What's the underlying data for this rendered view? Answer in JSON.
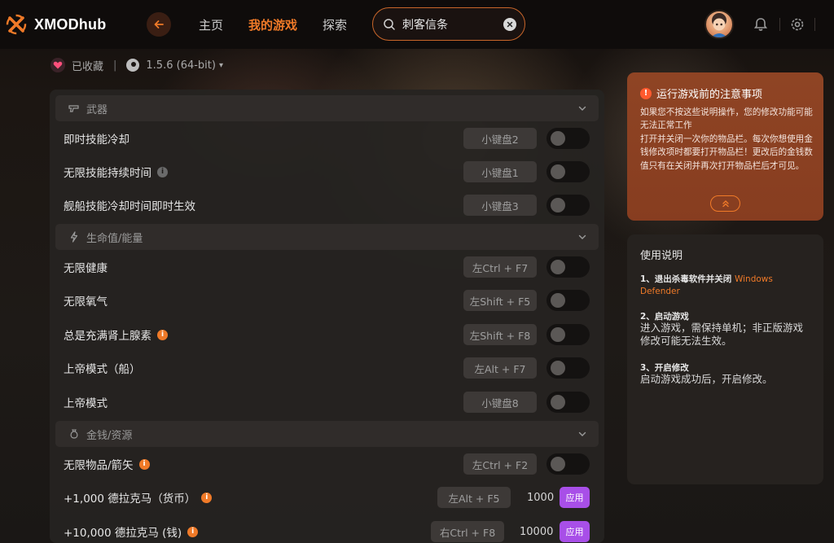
{
  "app": {
    "name": "XMODhub"
  },
  "nav": {
    "items": [
      {
        "label": "主页",
        "active": false
      },
      {
        "label": "我的游戏",
        "active": true
      },
      {
        "label": "探索",
        "active": false
      }
    ]
  },
  "search": {
    "value": "刺客信条",
    "placeholder": ""
  },
  "subheader": {
    "favorites_label": "已收藏",
    "version": "1.5.6 (64-bit)"
  },
  "categories": [
    {
      "name": "武器",
      "icon": "gun-icon",
      "items": [
        {
          "label": "即时技能冷却",
          "hotkey": "小键盘2",
          "type": "toggle",
          "on": false
        },
        {
          "label": "无限技能持续时间",
          "hotkey": "小键盘1",
          "type": "toggle",
          "on": false,
          "info": "grey"
        },
        {
          "label": "舰船技能冷却时间即时生效",
          "hotkey": "小键盘3",
          "type": "toggle",
          "on": false
        }
      ]
    },
    {
      "name": "生命值/能量",
      "icon": "lightning-icon",
      "items": [
        {
          "label": "无限健康",
          "hotkey": "左Ctrl + F7",
          "type": "toggle",
          "on": false
        },
        {
          "label": "无限氧气",
          "hotkey": "左Shift + F5",
          "type": "toggle",
          "on": false
        },
        {
          "label": "总是充满肾上腺素",
          "hotkey": "左Shift + F8",
          "type": "toggle",
          "on": false,
          "info": "orange"
        },
        {
          "label": "上帝模式（船）",
          "hotkey": "左Alt + F7",
          "type": "toggle",
          "on": false
        },
        {
          "label": "上帝模式",
          "hotkey": "小键盘8",
          "type": "toggle",
          "on": false
        }
      ]
    },
    {
      "name": "金钱/资源",
      "icon": "money-bag-icon",
      "items": [
        {
          "label": "无限物品/箭矢",
          "hotkey": "左Ctrl + F2",
          "type": "toggle",
          "on": false,
          "info": "orange"
        },
        {
          "label": "+1,000 德拉克马（货币）",
          "hotkey": "左Alt + F5",
          "type": "apply",
          "value": "1000",
          "button": "应用",
          "info": "orange"
        },
        {
          "label": "+10,000 德拉克马 (钱)",
          "hotkey": "右Ctrl + F8",
          "type": "apply",
          "value": "10000",
          "button": "应用",
          "info": "orange"
        }
      ]
    }
  ],
  "notice": {
    "title": "运行游戏前的注意事项",
    "body": "如果您不按这些说明操作，您的修改功能可能无法正常工作\n打开并关闭一次你的物品栏。每次你想使用金钱修改项时都要打开物品栏！更改后的金钱数值只有在关闭并再次打开物品栏后才可见。"
  },
  "guide": {
    "title": "使用说明",
    "steps": [
      {
        "title": "1、退出杀毒软件并关闭",
        "title_accent": "Windows Defender",
        "body": ""
      },
      {
        "title": "2、启动游戏",
        "title_accent": "",
        "body": "进入游戏，需保持单机；非正版游戏修改可能无法生效。"
      },
      {
        "title": "3、开启修改",
        "title_accent": "",
        "body": "启动游戏成功后，开启修改。"
      }
    ]
  },
  "colors": {
    "accent": "#f07a28",
    "apply": "#a84fe8",
    "notice_bg": "#8a3f22"
  }
}
